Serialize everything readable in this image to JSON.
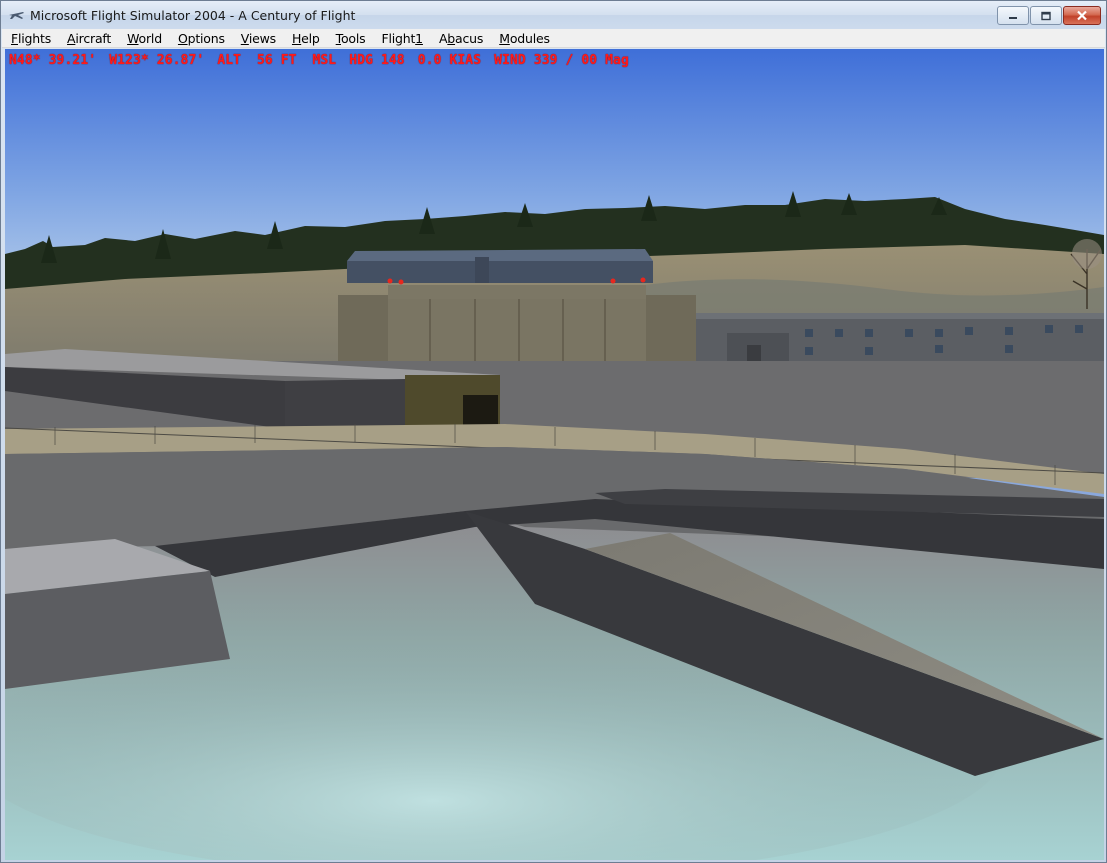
{
  "window": {
    "title": "Microsoft Flight Simulator 2004 - A Century of Flight",
    "icon": "airplane-icon"
  },
  "menu": [
    {
      "key": "F",
      "rest": "lights",
      "name": "menu-flights"
    },
    {
      "key": "A",
      "rest": "ircraft",
      "name": "menu-aircraft"
    },
    {
      "key": "W",
      "rest": "orld",
      "name": "menu-world"
    },
    {
      "key": "O",
      "rest": "ptions",
      "name": "menu-options"
    },
    {
      "key": "V",
      "rest": "iews",
      "name": "menu-views"
    },
    {
      "key": "H",
      "rest": "elp",
      "name": "menu-help"
    },
    {
      "key": "T",
      "rest": "ools",
      "name": "menu-tools"
    },
    {
      "pre": "Flight",
      "key": "1",
      "rest": "",
      "name": "menu-flight1"
    },
    {
      "key": "A",
      "rest": "bacus",
      "pre2": "",
      "name": "menu-abacus",
      "underlineIndex": 1
    },
    {
      "key": "M",
      "rest": "odules",
      "name": "menu-modules"
    }
  ],
  "hud": {
    "lat": "N48* 39.21'",
    "lon": "W123* 26.87'",
    "alt": "ALT  56 FT  MSL",
    "hdg": "HDG 148",
    "speed": "0.0 KIAS",
    "wind": "WIND 339 / 00 Mag"
  },
  "colors": {
    "hud_text": "#ff1a1a",
    "sky_top": "#3f6fd8",
    "sky_bottom": "#bcd2ec"
  }
}
